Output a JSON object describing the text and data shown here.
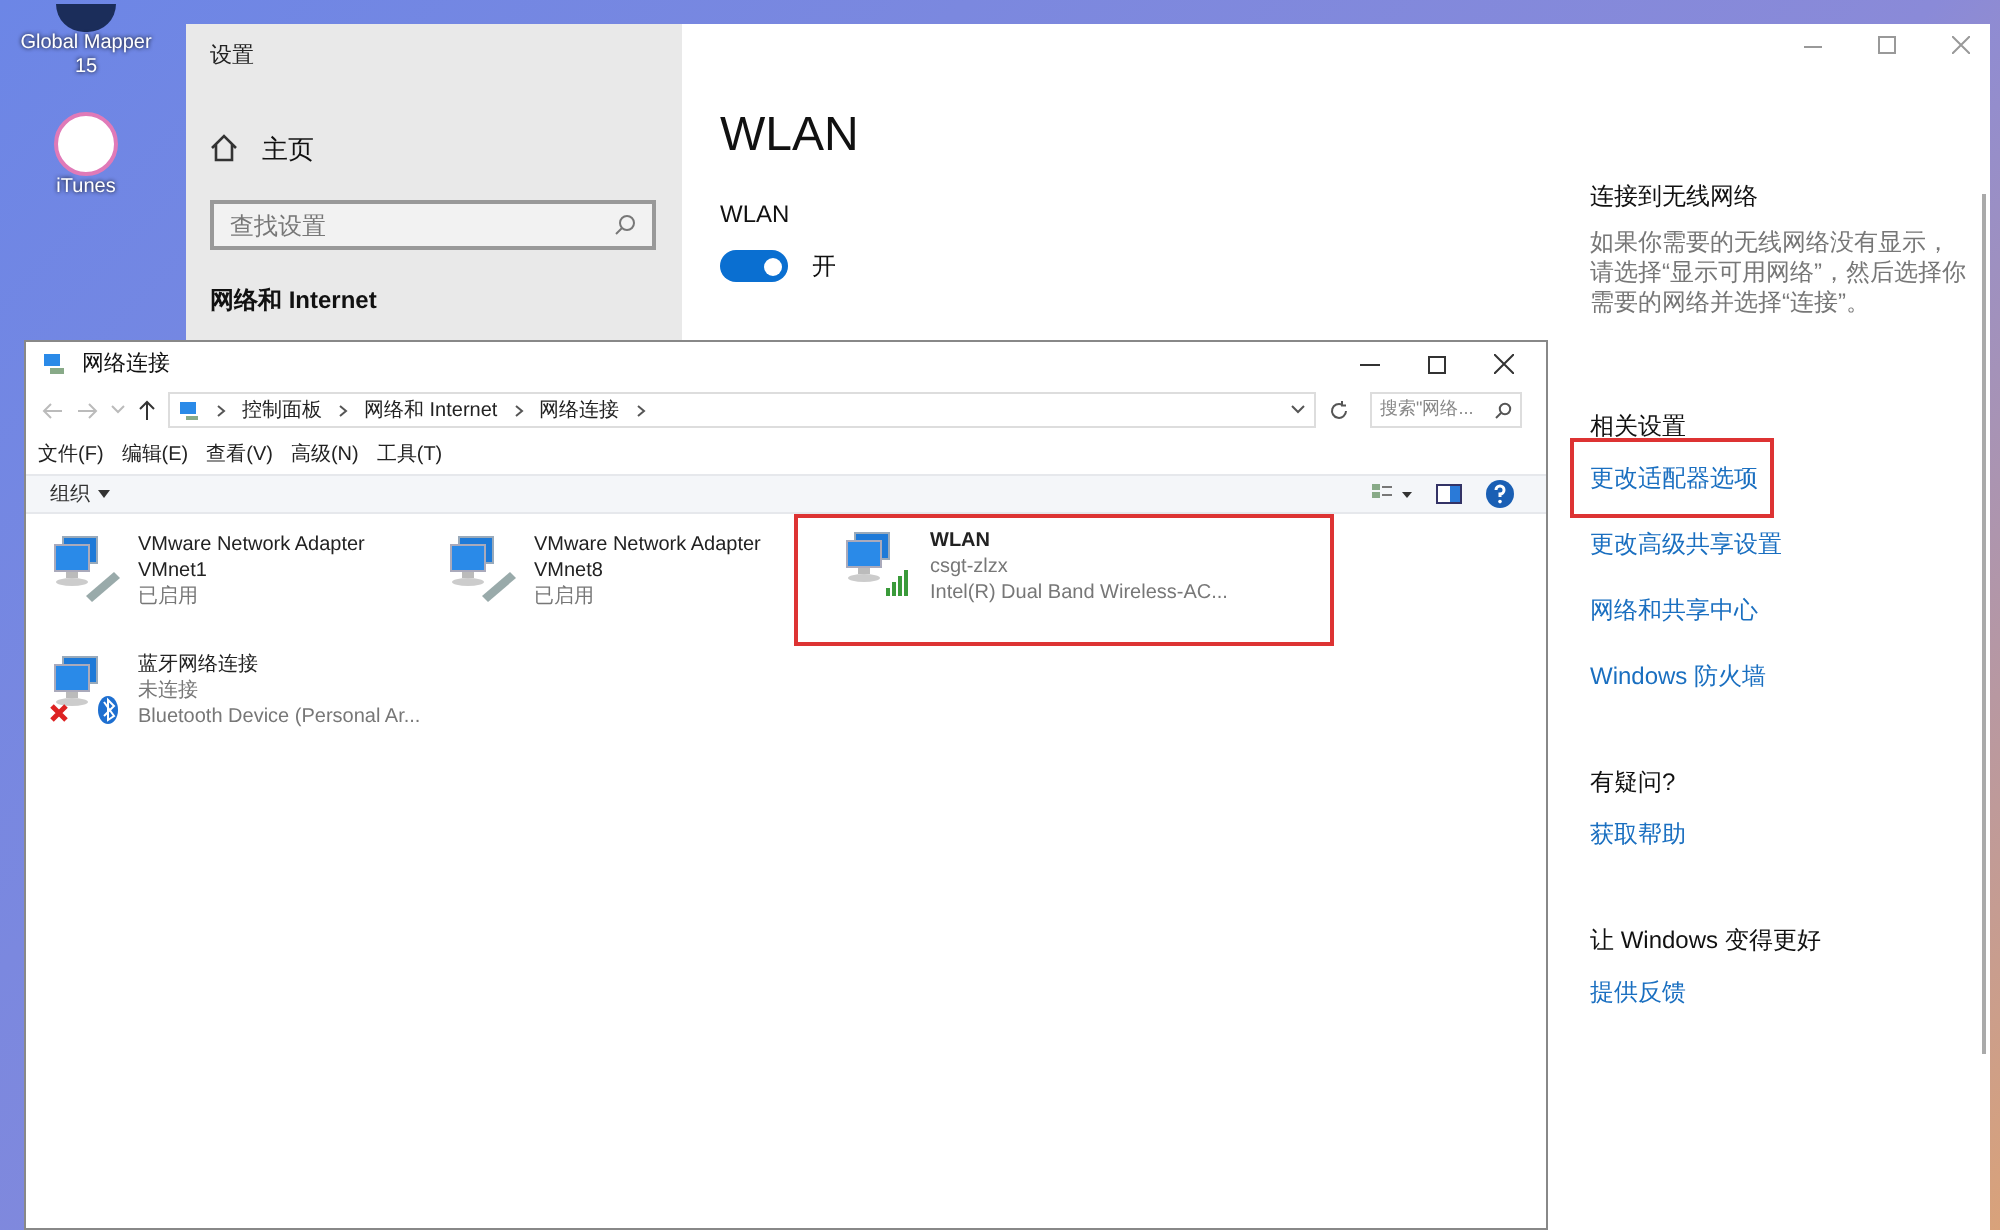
{
  "desktop": {
    "icons": [
      {
        "label": "Global Mapper 15"
      },
      {
        "label": "iTunes"
      }
    ]
  },
  "settings_window": {
    "title": "设置",
    "nav": {
      "home": "主页",
      "search_placeholder": "查找设置",
      "section": "网络和 Internet"
    },
    "page": {
      "heading": "WLAN",
      "toggle": {
        "label": "WLAN",
        "on": true,
        "state_text": "开"
      }
    },
    "side": [
      {
        "heading": "连接到无线网络",
        "text": "如果你需要的无线网络没有显示，请选择“显示可用网络”，然后选择你需要的网络并选择“连接”。"
      },
      {
        "heading": "相关设置",
        "links": [
          {
            "label": "更改适配器选项",
            "highlighted": true
          },
          {
            "label": "更改高级共享设置",
            "highlighted": false
          },
          {
            "label": "网络和共享中心",
            "highlighted": false
          },
          {
            "label": "Windows 防火墙",
            "highlighted": false
          }
        ]
      },
      {
        "heading": "有疑问?",
        "links": [
          {
            "label": "获取帮助",
            "highlighted": false
          }
        ]
      },
      {
        "heading": "让 Windows 变得更好",
        "links": [
          {
            "label": "提供反馈",
            "highlighted": false
          }
        ]
      }
    ]
  },
  "explorer_window": {
    "title": "网络连接",
    "breadcrumbs": [
      "控制面板",
      "网络和 Internet",
      "网络连接"
    ],
    "search_placeholder": "搜索\"网络...",
    "menu": [
      "文件(F)",
      "编辑(E)",
      "查看(V)",
      "高级(N)",
      "工具(T)"
    ],
    "organize": "组织",
    "items": [
      {
        "kind": "wired",
        "name": "VMware Network Adapter VMnet1",
        "status": "已启用",
        "highlighted": false
      },
      {
        "kind": "wired",
        "name": "VMware Network Adapter VMnet8",
        "status": "已启用",
        "highlighted": false
      },
      {
        "kind": "wireless",
        "name": "WLAN",
        "status": "csgt-zlzx",
        "device": "Intel(R) Dual Band Wireless-AC...",
        "highlighted": true
      },
      {
        "kind": "bluetooth",
        "name": "蓝牙网络连接",
        "status": "未连接",
        "device": "Bluetooth Device (Personal Ar...",
        "highlighted": false
      }
    ]
  }
}
